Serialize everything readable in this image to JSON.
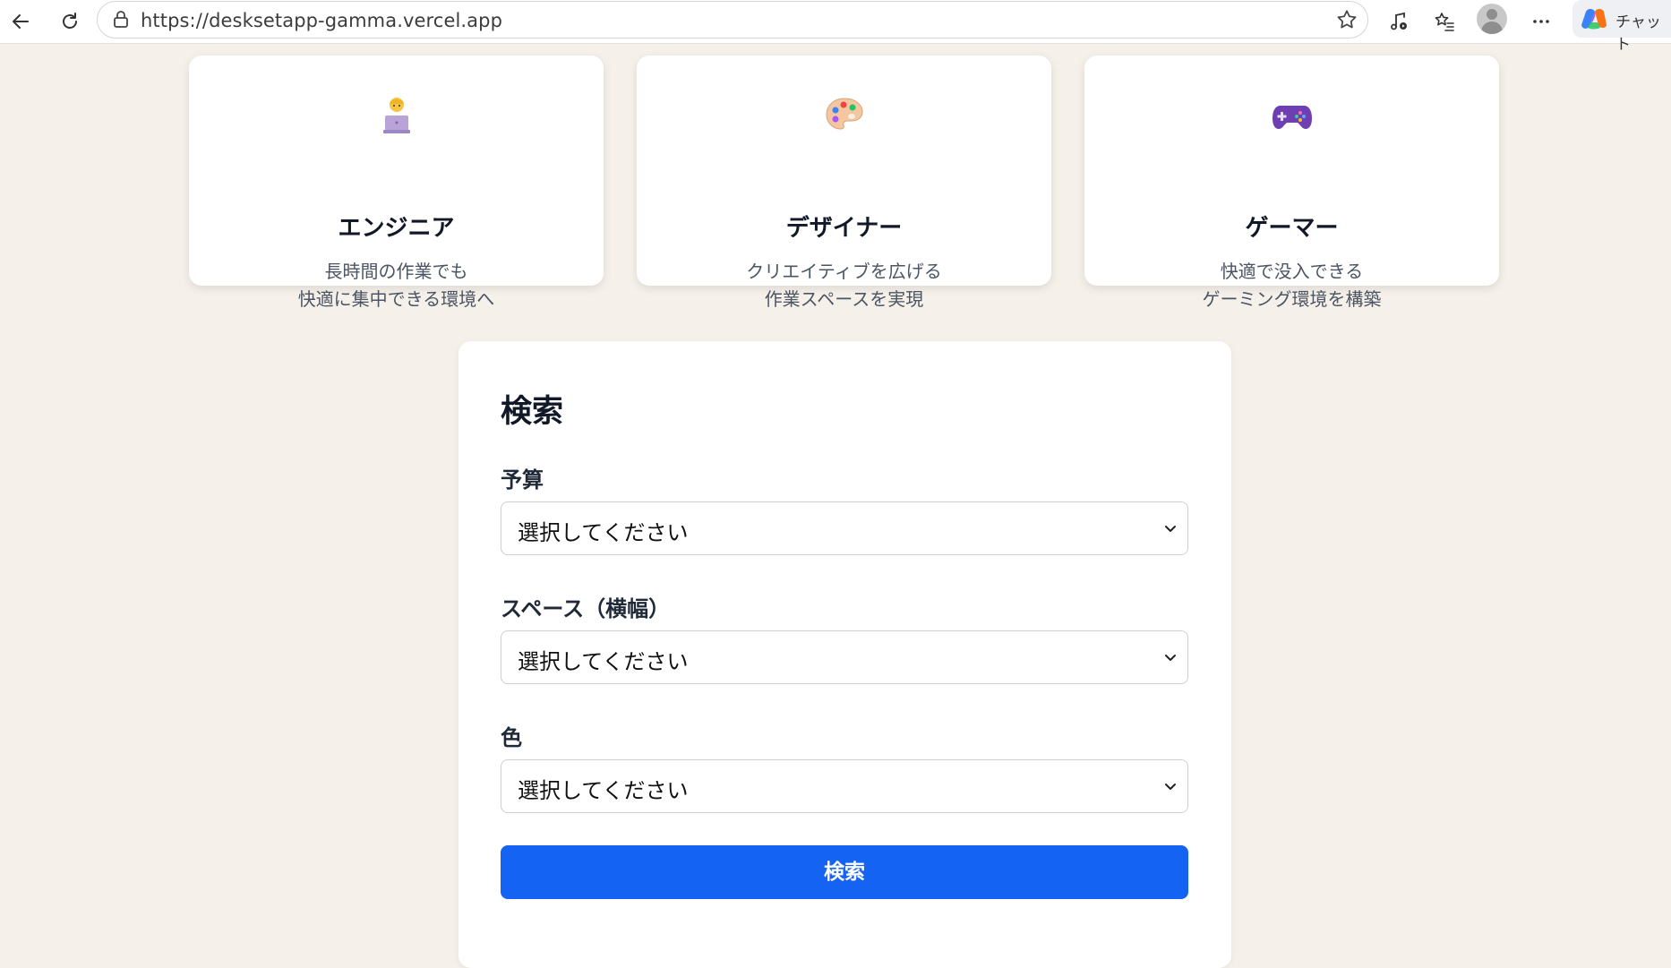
{
  "browser": {
    "url": "https://desksetapp-gamma.vercel.app",
    "chat_label": "チャット",
    "icons": [
      "back-icon",
      "refresh-icon",
      "lock-icon",
      "favorite-star-icon",
      "media-icon",
      "favorites-list-icon",
      "profile-avatar",
      "more-icon",
      "copilot-icon"
    ]
  },
  "cards": [
    {
      "icon": "technologist-emoji",
      "title": "エンジニア",
      "desc_line1": "長時間の作業でも",
      "desc_line2": "快適に集中できる環境へ"
    },
    {
      "icon": "artist-palette-emoji",
      "title": "デザイナー",
      "desc_line1": "クリエイティブを広げる",
      "desc_line2": "作業スペースを実現"
    },
    {
      "icon": "game-controller-emoji",
      "title": "ゲーマー",
      "desc_line1": "快適で没入できる",
      "desc_line2": "ゲーミング環境を構築"
    }
  ],
  "search": {
    "title": "検索",
    "fields": [
      {
        "label": "予算",
        "value": "選択してください"
      },
      {
        "label": "スペース（横幅）",
        "value": "選択してください"
      },
      {
        "label": "色",
        "value": "選択してください"
      }
    ],
    "submit_label": "検索"
  },
  "colors": {
    "page_bg": "#f6f0ea",
    "primary_button": "#1463f3"
  }
}
